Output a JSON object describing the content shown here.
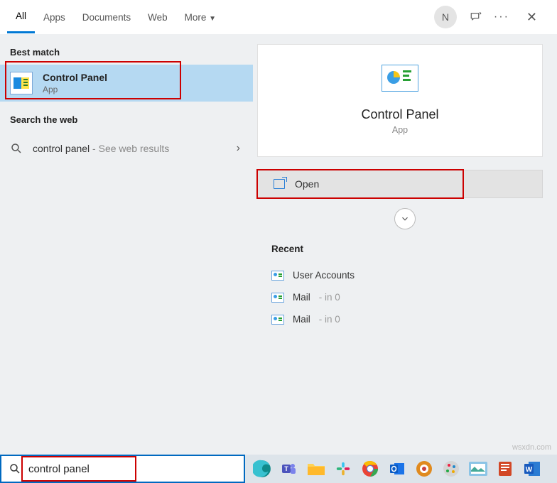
{
  "tabs": {
    "all": "All",
    "apps": "Apps",
    "documents": "Documents",
    "web": "Web",
    "more": "More"
  },
  "user_initial": "N",
  "left": {
    "best_match_label": "Best match",
    "result": {
      "title": "Control Panel",
      "sub": "App"
    },
    "search_web_label": "Search the web",
    "web_query": "control panel",
    "web_suffix": " - See web results"
  },
  "detail": {
    "title": "Control Panel",
    "sub": "App",
    "open_label": "Open",
    "recent_label": "Recent",
    "recent": [
      {
        "label": "User Accounts",
        "suffix": ""
      },
      {
        "label": "Mail",
        "suffix": " - in 0"
      },
      {
        "label": "Mail",
        "suffix": " - in 0"
      }
    ]
  },
  "search_value": "control panel",
  "watermark": "wsxdn.com"
}
